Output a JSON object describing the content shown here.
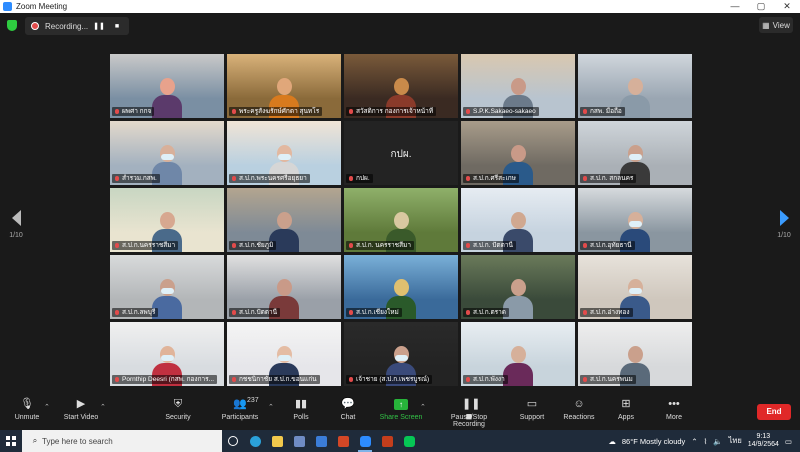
{
  "window": {
    "title": "Zoom Meeting",
    "controls": [
      "—",
      "▢",
      "✕"
    ]
  },
  "topbar": {
    "recording_label": "Recording...",
    "view_label": "View"
  },
  "pagination": {
    "left": "1/10",
    "right": "1/10"
  },
  "participants": [
    {
      "name": "ผพศา กกจ",
      "scene": "office"
    },
    {
      "name": "พระครูสังฆรักษ์ศักดา สุนทโร",
      "scene": "monk",
      "active": true
    },
    {
      "name": "สวัสดิการ กองการเจ้าหน้าที่",
      "scene": "photo"
    },
    {
      "name": "S.P.K.Sakaeo-sakaeo",
      "scene": "office2"
    },
    {
      "name": "กสพ. มือถือ",
      "scene": "office3"
    },
    {
      "name": "สำรวม.กสพ.",
      "scene": "masked"
    },
    {
      "name": "ส.ป.ก.พระนครศรีอยุธยา",
      "scene": "masked2"
    },
    {
      "name": "กปผ.",
      "scene": "blank",
      "center_label": "กปผ."
    },
    {
      "name": "ส.ป.ก.ศรีสะเกษ",
      "scene": "room"
    },
    {
      "name": "ส.ป.ก. สกลนคร",
      "scene": "masked3"
    },
    {
      "name": "ส.ป.ก.นครราชสีมา",
      "scene": "conf"
    },
    {
      "name": "ส.ป.ก.ชัยภูมิ",
      "scene": "conf2"
    },
    {
      "name": "ส.ป.ก. นครราชสีมา",
      "scene": "field"
    },
    {
      "name": "ส.ป.ก. ปัตตานี",
      "scene": "office4"
    },
    {
      "name": "ส.ป.ก.อุทัยธานี",
      "scene": "masked4"
    },
    {
      "name": "ส.ป.ก.ลพบุรี",
      "scene": "masked5"
    },
    {
      "name": "ส.ป.ก.ปัตตานี",
      "scene": "hall"
    },
    {
      "name": "ส.ป.ก.เชียงใหม่",
      "scene": "temple"
    },
    {
      "name": "ส.ป.ก.ตราด",
      "scene": "office5"
    },
    {
      "name": "ส.ป.ก.อ่างทอง",
      "scene": "masked6"
    },
    {
      "name": "Pornthip Deesri (กสพ. กองการ...",
      "scene": "woman"
    },
    {
      "name": "กชชนิกาชัย ส.ป.ก.ขอนแก่น",
      "scene": "woman2"
    },
    {
      "name": "เจ้าชาย (ส.ป.ก.เพชรบูรณ์)",
      "scene": "man"
    },
    {
      "name": "ส.ป.ก.พังงา",
      "scene": "group"
    },
    {
      "name": "ส.ป.ก.นครพนม",
      "scene": "office6"
    }
  ],
  "toolbar": {
    "unmute": "Unmute",
    "stop_video": "Start Video",
    "security": "Security",
    "participants": "Participants",
    "participant_count": "237",
    "polls": "Polls",
    "chat": "Chat",
    "share": "Share Screen",
    "record": "Pause/Stop Recording",
    "support": "Support",
    "reactions": "Reactions",
    "apps": "Apps",
    "more": "More",
    "end": "End"
  },
  "taskbar": {
    "search_placeholder": "Type here to search",
    "weather": "86°F  Mostly cloudy",
    "lang": "ไทย",
    "time": "9:13",
    "date": "14/9/2564"
  },
  "colors": {
    "accent": "#2d8cff",
    "end": "#e02828",
    "active_speaker": "#c9e35a",
    "share": "#27b43a"
  }
}
